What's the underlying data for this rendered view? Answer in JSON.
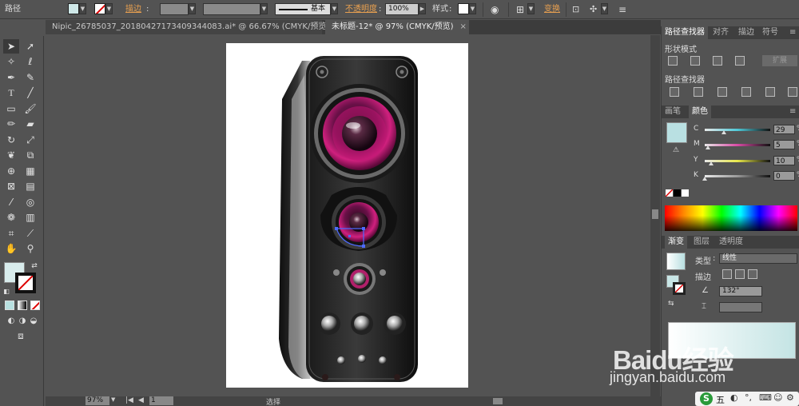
{
  "control_bar": {
    "selection_label": "路径",
    "stroke_label": "描边",
    "stroke_profile": "基本",
    "opacity_label": "不透明度",
    "opacity_value": "100%",
    "style_label": "样式",
    "transform_label": "变换",
    "fill_color": "#cfe8e8",
    "stroke_color": "none"
  },
  "doc_tabs": [
    {
      "label": "Nipic_26785037_20180427173409344083.ai* @ 66.67% (CMYK/预览)"
    },
    {
      "label": "未标题-12* @ 97% (CMYK/预览)"
    }
  ],
  "panels": {
    "pathfinder": {
      "tabs": [
        "路径查找器",
        "对齐",
        "描边",
        "符号"
      ],
      "shape_modes_label": "形状模式",
      "expand_label": "扩展",
      "pathfinders_label": "路径查找器"
    },
    "color": {
      "tabs": [
        "画笔",
        "颜色"
      ],
      "channels": [
        {
          "name": "C",
          "value": "29",
          "level": 0.29,
          "track": "#4fc9d8"
        },
        {
          "name": "M",
          "value": "5",
          "level": 0.05,
          "track": "#d94ba5"
        },
        {
          "name": "Y",
          "value": "10",
          "level": 0.1,
          "track": "#e8e84a"
        },
        {
          "name": "K",
          "value": "0",
          "level": 0.0,
          "track": "#999999"
        }
      ],
      "swatch_color": "#b9e0e2"
    },
    "gradient": {
      "tabs": [
        "渐变",
        "图层",
        "透明度"
      ],
      "type_label": "类型",
      "type_value": "线性",
      "stroke_label": "描边",
      "angle_value": "132°"
    }
  },
  "status": {
    "zoom": "97%",
    "page": "1",
    "status_label": "选择"
  },
  "watermark": {
    "logo": "Baidu经验",
    "url": "jingyan.baidu.com"
  },
  "ime": {
    "label": "五"
  }
}
